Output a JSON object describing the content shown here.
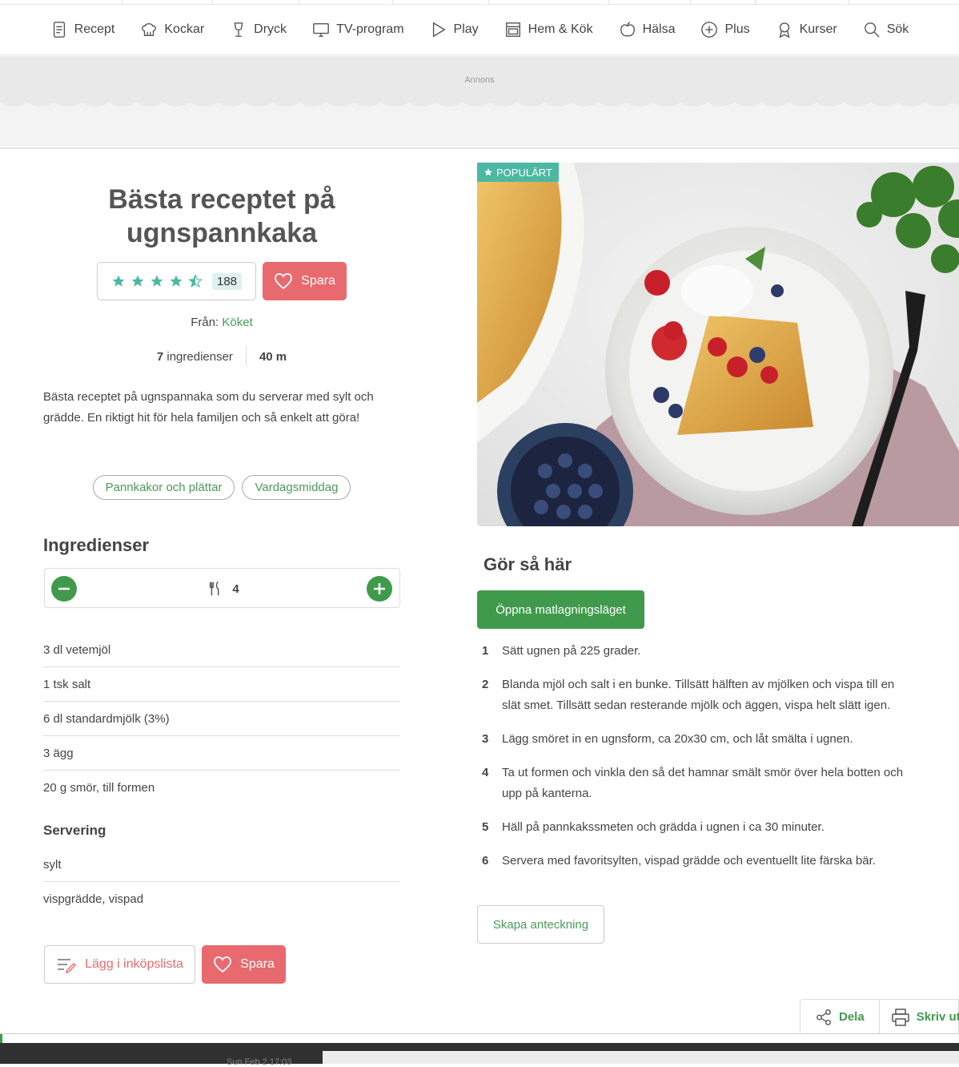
{
  "nav": {
    "items": [
      {
        "label": "Recept",
        "icon": "recipe-book-icon"
      },
      {
        "label": "Kockar",
        "icon": "chef-hat-icon"
      },
      {
        "label": "Dryck",
        "icon": "wine-glass-icon"
      },
      {
        "label": "TV-program",
        "icon": "tv-icon"
      },
      {
        "label": "Play",
        "icon": "play-icon"
      },
      {
        "label": "Hem & Kök",
        "icon": "kitchen-icon"
      },
      {
        "label": "Hälsa",
        "icon": "apple-icon"
      },
      {
        "label": "Plus",
        "icon": "plus-circle-icon"
      },
      {
        "label": "Kurser",
        "icon": "badge-icon"
      },
      {
        "label": "Sök",
        "icon": "search-icon"
      }
    ]
  },
  "ad": {
    "label": "Annons"
  },
  "recipe": {
    "title": "Bästa receptet på ugnspannkaka",
    "rating": {
      "stars": 4.5,
      "count": "188"
    },
    "save_label": "Spara",
    "source_prefix": "Från:",
    "source_name": "Köket",
    "ingredient_count": "7",
    "ingredient_word": "ingredienser",
    "time": "40 m",
    "description": "Bästa receptet på ugnspannaka som du serverar med sylt och grädde. En riktigt hit för hela familjen och så enkelt att göra!",
    "tags": [
      "Pannkakor och plättar",
      "Vardagsmiddag"
    ],
    "badge": "POPULÄRT"
  },
  "ingredients": {
    "heading": "Ingredienser",
    "servings": "4",
    "items": [
      "3 dl vetemjöl",
      "1 tsk salt",
      "6 dl standardmjölk (3%)",
      "3 ägg",
      "20 g smör, till formen"
    ],
    "serving_heading": "Servering",
    "serving_items": [
      "sylt",
      "vispgrädde, vispad"
    ],
    "shopping_label": "Lägg i inköpslista",
    "save_label": "Spara"
  },
  "instructions": {
    "heading": "Gör så här",
    "cook_mode_label": "Öppna matlagningsläget",
    "steps": [
      {
        "n": "1",
        "text": "Sätt ugnen på 225 grader."
      },
      {
        "n": "2",
        "text": "Blanda mjöl och salt i en bunke. Tillsätt hälften av mjölken och vispa till en slät smet. Tillsätt sedan resterande mjölk och äggen, vispa helt slätt igen."
      },
      {
        "n": "3",
        "text": "Lägg smöret in en ugnsform, ca 20x30 cm, och låt smälta i ugnen."
      },
      {
        "n": "4",
        "text": "Ta ut formen och vinkla den så det hamnar smält smör över hela botten och upp på kanterna."
      },
      {
        "n": "5",
        "text": "Häll på pannkakssmeten och grädda i ugnen i ca 30 minuter."
      },
      {
        "n": "6",
        "text": "Servera med favoritsylten, vispad grädde och eventuellt lite färska bär."
      }
    ],
    "note_label": "Skapa anteckning"
  },
  "share": {
    "share_label": "Dela",
    "print_label": "Skriv ut"
  },
  "taskbar": {
    "clock": "Sun Feb 2 17:03"
  },
  "colors": {
    "green": "#3f9a4c",
    "teal": "#4cb8a2",
    "coral": "#e86a6f"
  }
}
